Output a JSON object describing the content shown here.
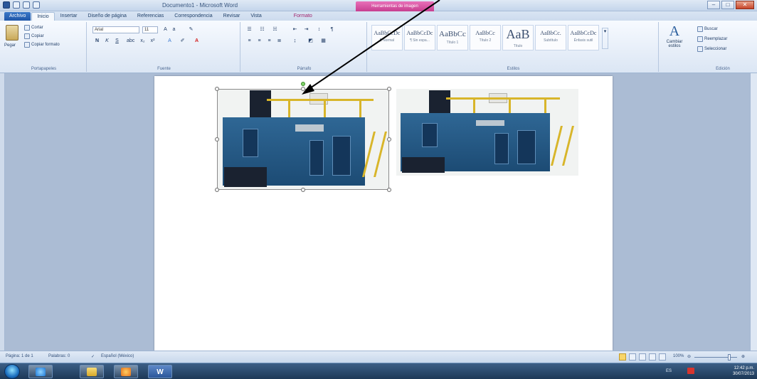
{
  "window": {
    "title": "Documento1 - Microsoft Word",
    "context_tab_group": "Herramientas de imagen"
  },
  "tabs": [
    "Archivo",
    "Inicio",
    "Insertar",
    "Diseño de página",
    "Referencias",
    "Correspondencia",
    "Revisar",
    "Vista",
    "Formato"
  ],
  "active_tab": "Inicio",
  "ribbon": {
    "clipboard": {
      "label": "Portapapeles",
      "paste": "Pegar",
      "cut": "Cortar",
      "copy": "Copiar",
      "format_painter": "Copiar formato"
    },
    "font": {
      "label": "Fuente",
      "font_name": "Arial",
      "font_size": "11"
    },
    "paragraph": {
      "label": "Párrafo"
    },
    "styles": {
      "label": "Estilos",
      "items": [
        {
          "sample": "AaBbCcDc",
          "name": "¶ Normal"
        },
        {
          "sample": "AaBbCcDc",
          "name": "¶ Sin espa..."
        },
        {
          "sample": "AaBbCc",
          "name": "Título 1"
        },
        {
          "sample": "AaBbCc",
          "name": "Título 2"
        },
        {
          "sample": "AaB",
          "name": "Título"
        },
        {
          "sample": "AaBbCc.",
          "name": "Subtítulo"
        },
        {
          "sample": "AaBbCcDc",
          "name": "Énfasis sutil"
        }
      ],
      "change_styles": "Cambiar estilos"
    },
    "editing": {
      "label": "Edición",
      "find": "Buscar",
      "replace": "Reemplazar",
      "select": "Seleccionar"
    }
  },
  "status": {
    "page": "Página: 1 de 1",
    "words": "Palabras: 0",
    "language": "Español (México)",
    "zoom": "100%",
    "zoom_fraction": 0.82
  },
  "taskbar": {
    "lang": "ES",
    "time": "12:42 p.m.",
    "date": "30/07/2013"
  }
}
